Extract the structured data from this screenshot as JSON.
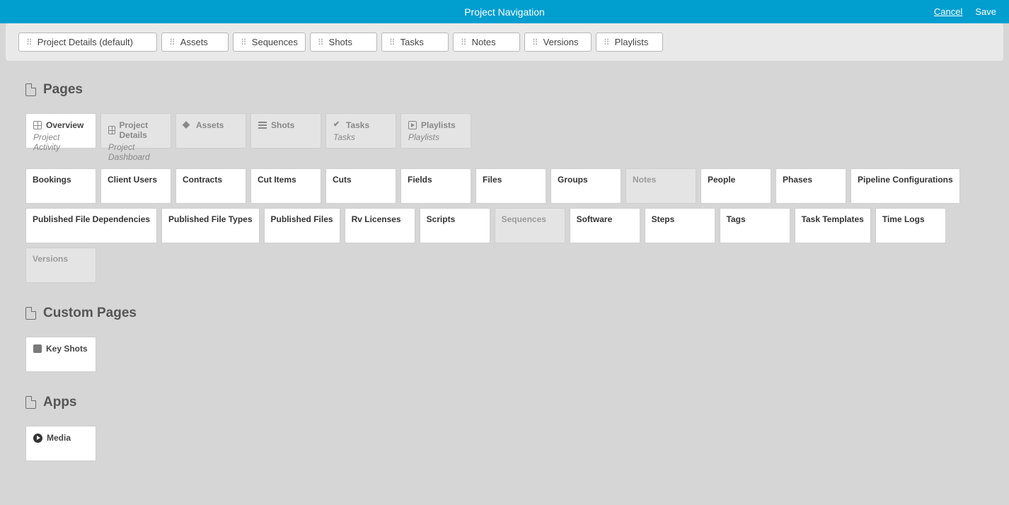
{
  "header": {
    "title": "Project Navigation",
    "cancel": "Cancel",
    "save": "Save"
  },
  "nav_tabs": [
    {
      "label": "Project Details (default)",
      "wide": true
    },
    {
      "label": "Assets"
    },
    {
      "label": "Sequences"
    },
    {
      "label": "Shots"
    },
    {
      "label": "Tasks"
    },
    {
      "label": "Notes"
    },
    {
      "label": "Versions"
    },
    {
      "label": "Playlists"
    }
  ],
  "sections": {
    "pages": {
      "title": "Pages",
      "featured": [
        {
          "title": "Overview",
          "sub": "Project Activity",
          "icon": "grid",
          "active": true
        },
        {
          "title": "Project Details",
          "sub": "Project Dashboard",
          "icon": "grid",
          "active": false
        },
        {
          "title": "Assets",
          "sub": "",
          "icon": "cube",
          "active": false
        },
        {
          "title": "Shots",
          "sub": "",
          "icon": "list",
          "active": false
        },
        {
          "title": "Tasks",
          "sub": "Tasks",
          "icon": "check",
          "active": false
        },
        {
          "title": "Playlists",
          "sub": "Playlists",
          "icon": "play",
          "active": false
        }
      ],
      "row1": [
        {
          "label": "Bookings"
        },
        {
          "label": "Client Users"
        },
        {
          "label": "Contracts"
        },
        {
          "label": "Cut Items"
        },
        {
          "label": "Cuts"
        },
        {
          "label": "Fields"
        },
        {
          "label": "Files"
        },
        {
          "label": "Groups"
        },
        {
          "label": "Notes",
          "disabled": true
        },
        {
          "label": "People"
        },
        {
          "label": "Phases"
        },
        {
          "label": "Pipeline Configurations"
        }
      ],
      "row2": [
        {
          "label": "Published File Dependencies"
        },
        {
          "label": "Published File Types"
        },
        {
          "label": "Published Files"
        },
        {
          "label": "Rv Licenses"
        },
        {
          "label": "Scripts"
        },
        {
          "label": "Sequences",
          "disabled": true
        },
        {
          "label": "Software"
        },
        {
          "label": "Steps"
        },
        {
          "label": "Tags"
        },
        {
          "label": "Task Templates"
        },
        {
          "label": "Time Logs"
        },
        {
          "label": "Versions",
          "disabled": true
        }
      ]
    },
    "custom": {
      "title": "Custom Pages",
      "items": [
        {
          "title": "Key Shots",
          "icon": "gray-sq"
        }
      ]
    },
    "apps": {
      "title": "Apps",
      "items": [
        {
          "title": "Media",
          "icon": "play-circle"
        }
      ]
    }
  }
}
